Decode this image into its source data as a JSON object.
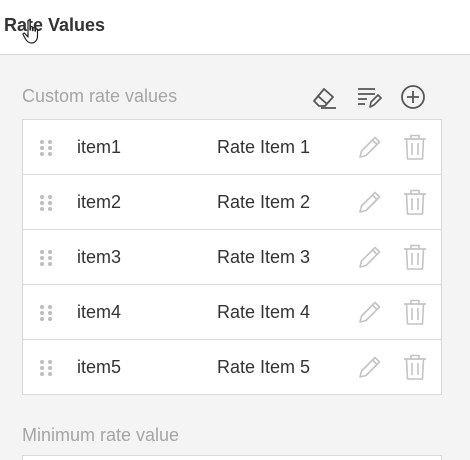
{
  "header": {
    "title": "Rate Values"
  },
  "custom_rates": {
    "title": "Custom rate values",
    "toolbar": {
      "clear_icon": "eraser-icon",
      "bulk_edit_icon": "list-edit-icon",
      "add_icon": "add-circle-icon"
    },
    "items": [
      {
        "name": "item1",
        "label": "Rate Item 1"
      },
      {
        "name": "item2",
        "label": "Rate Item 2"
      },
      {
        "name": "item3",
        "label": "Rate Item 3"
      },
      {
        "name": "item4",
        "label": "Rate Item 4"
      },
      {
        "name": "item5",
        "label": "Rate Item 5"
      }
    ]
  },
  "minimum_rate": {
    "title": "Minimum rate value"
  },
  "colors": {
    "icon": "#555555",
    "icon_muted": "#c4c4c4",
    "drag_handle": "#bdbdbd",
    "section_title": "#a5a5a5",
    "text": "#333333"
  }
}
